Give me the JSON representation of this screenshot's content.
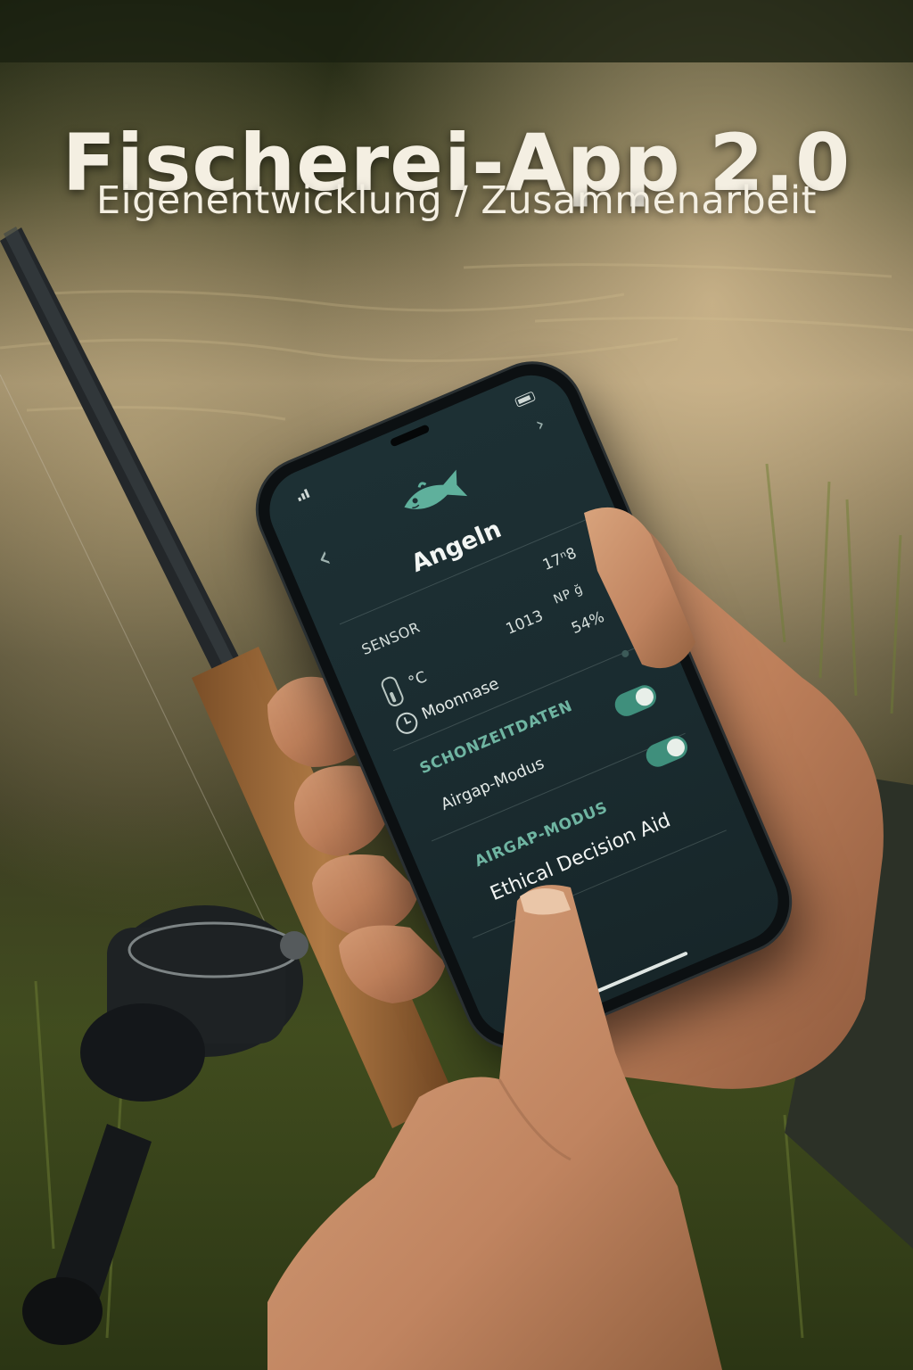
{
  "headline": {
    "title": "Fischerei-App 2.0",
    "subtitle": "Eigenentwicklung / Zusammenarbeit"
  },
  "phone": {
    "app_title": "Angeln",
    "logo_icon": "fish-icon",
    "sensor": {
      "label": "SENSOR",
      "time": "17ⁿ8",
      "pressure_value": "1013",
      "pressure_unit": "NP ğ",
      "temperature_unit": "°C",
      "humidity": "54%",
      "moon_label": "Moonnase"
    },
    "sections": [
      {
        "header": "SCHONZEITDATEN",
        "item": "Airgap-Modus",
        "toggle_on": true
      },
      {
        "header": "AIRGAP-MODUS",
        "item": "Ethical Decision Aid",
        "toggle_on": true
      }
    ]
  },
  "colors": {
    "accent": "#6fb5a2",
    "toggle": "#3f8f7c",
    "screen": "#1d3034"
  }
}
